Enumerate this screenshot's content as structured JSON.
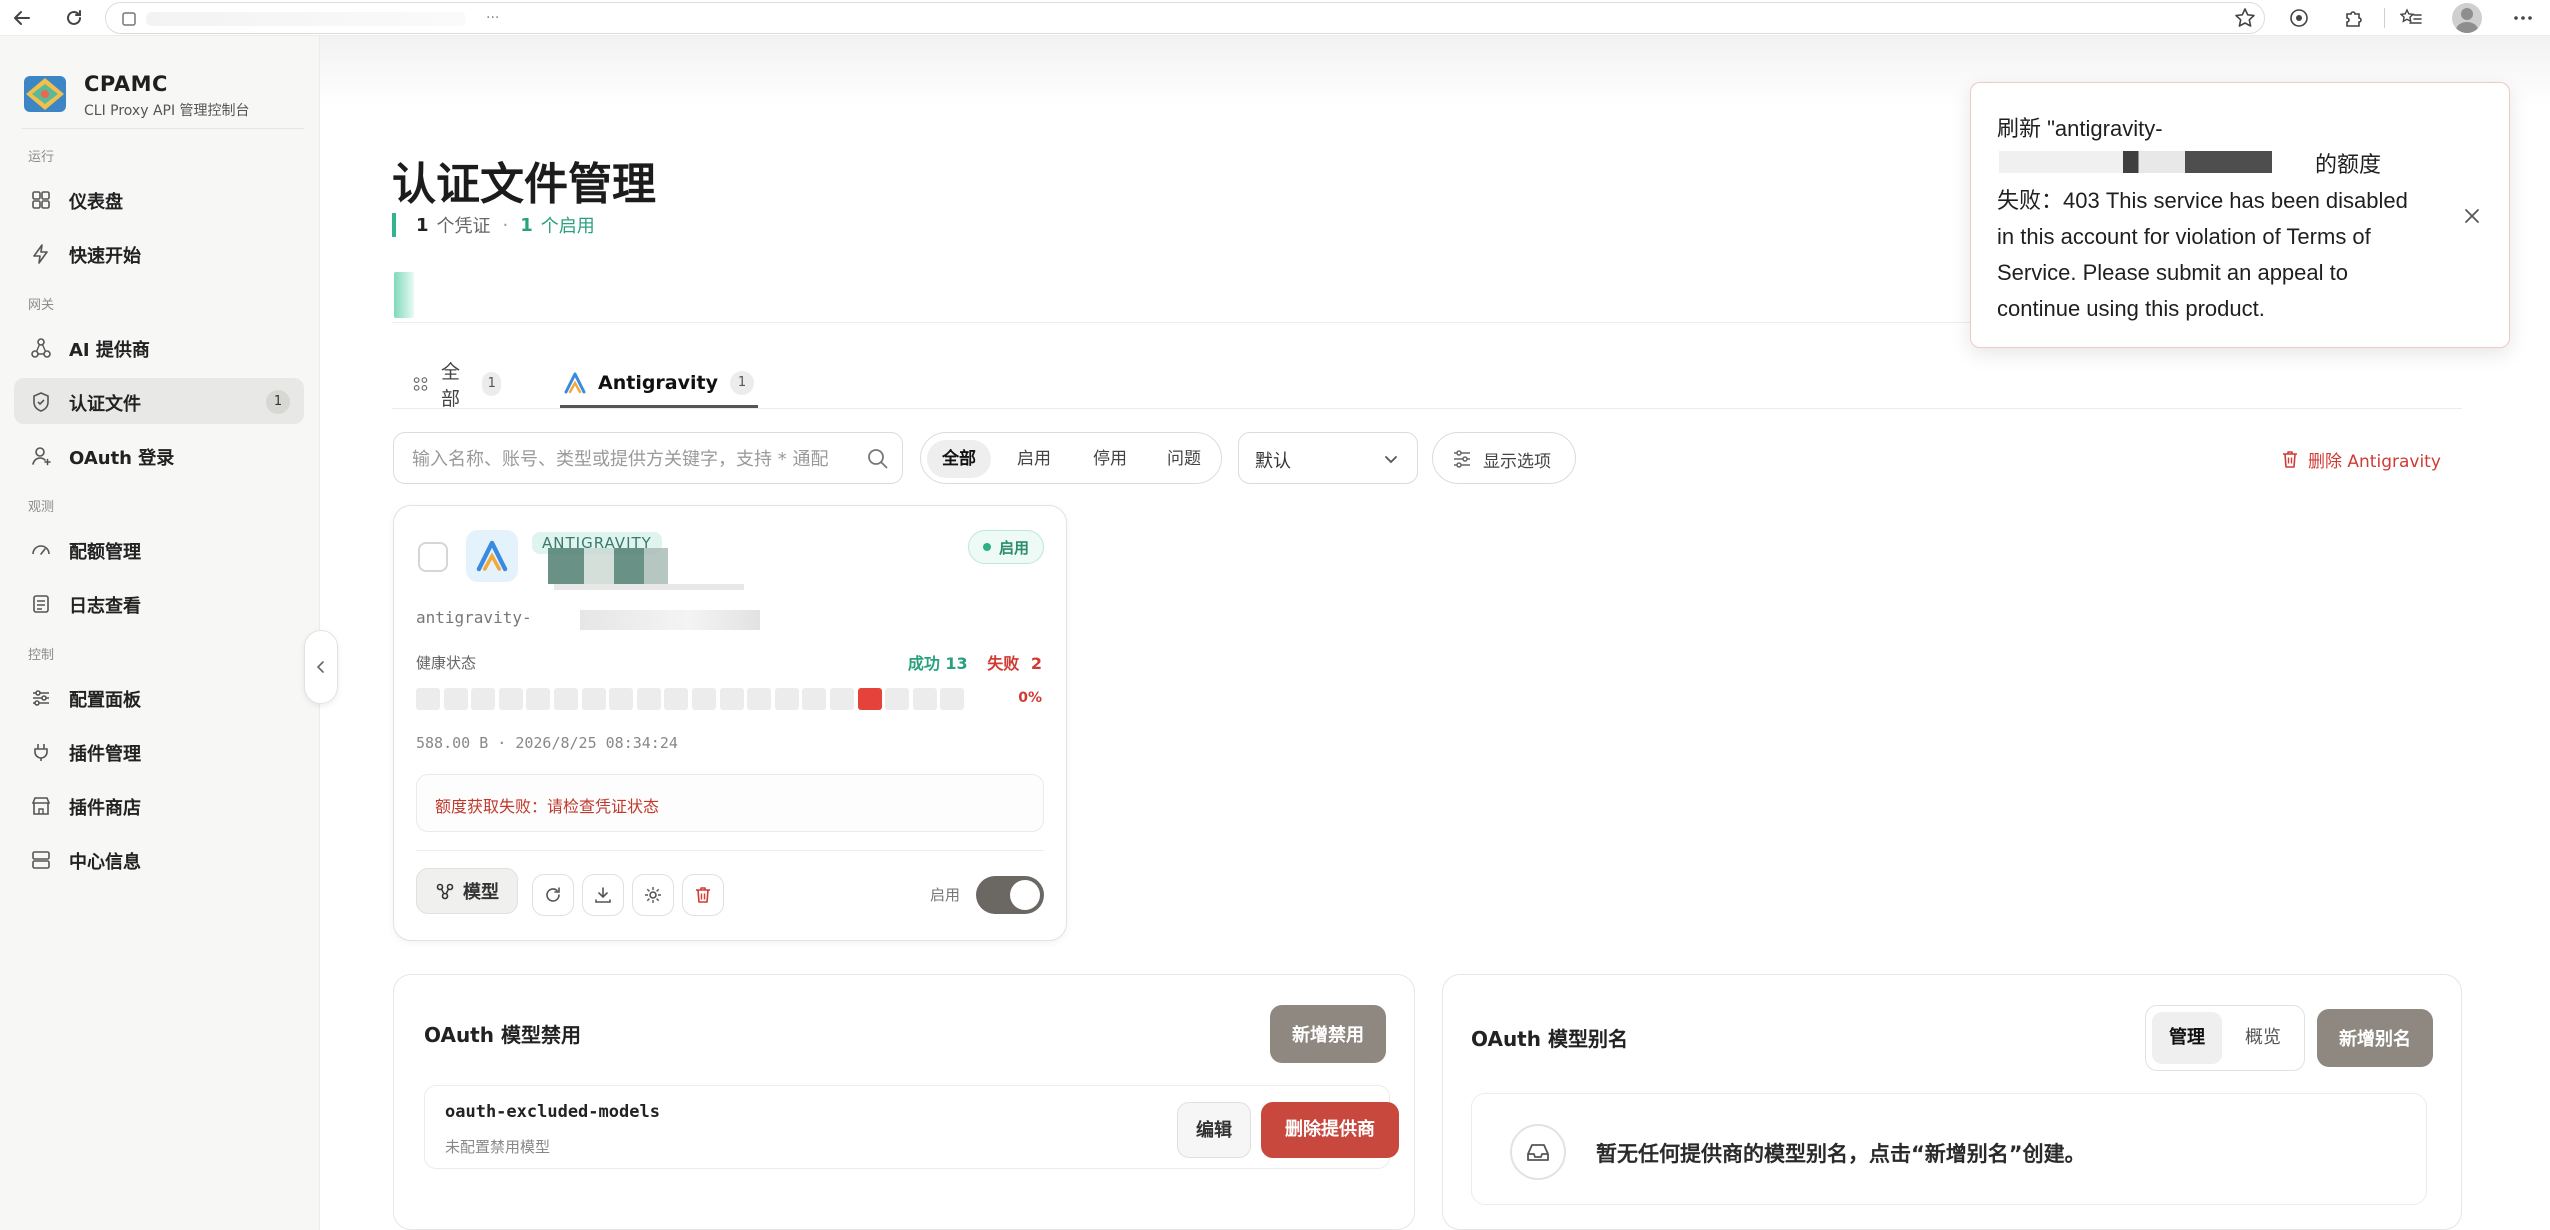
{
  "browser": {
    "address_ellipsis": "...",
    "back_icon": "back-arrow-icon",
    "reload_icon": "reload-icon"
  },
  "sidebar": {
    "brand": {
      "name": "CPAMC",
      "subtitle": "CLI Proxy API 管理控制台"
    },
    "sections": [
      {
        "label": "运行",
        "items": [
          {
            "label": "仪表盘",
            "icon": "dashboard-icon"
          },
          {
            "label": "快速开始",
            "icon": "bolt-icon"
          }
        ]
      },
      {
        "label": "网关",
        "items": [
          {
            "label": "AI 提供商",
            "icon": "providers-icon"
          },
          {
            "label": "认证文件",
            "icon": "shield-icon",
            "active": true,
            "count": "1"
          },
          {
            "label": "OAuth 登录",
            "icon": "user-icon"
          }
        ]
      },
      {
        "label": "观测",
        "items": [
          {
            "label": "配额管理",
            "icon": "gauge-icon"
          },
          {
            "label": "日志查看",
            "icon": "log-icon"
          }
        ]
      },
      {
        "label": "控制",
        "items": [
          {
            "label": "配置面板",
            "icon": "sliders-icon"
          },
          {
            "label": "插件管理",
            "icon": "plug-icon"
          },
          {
            "label": "插件商店",
            "icon": "store-icon"
          },
          {
            "label": "中心信息",
            "icon": "server-icon"
          }
        ]
      }
    ]
  },
  "page": {
    "title": "认证文件管理",
    "credentials_count": "1",
    "credentials_label": "个凭证",
    "separator": "·",
    "enabled_count": "1",
    "enabled_label": "个启用"
  },
  "tabs": [
    {
      "label": "全部",
      "count": "1",
      "icon": "all-icon"
    },
    {
      "label": "Antigravity",
      "count": "1",
      "icon": "antigravity-logo-icon",
      "active": true
    }
  ],
  "filters": {
    "search_placeholder": "输入名称、账号、类型或提供方关键字，支持 * 通配",
    "segments": [
      "全部",
      "启用",
      "停用",
      "问题"
    ],
    "active_segment": "全部",
    "sort_value": "默认",
    "display_options": "显示选项",
    "delete_provider": "删除 Antigravity"
  },
  "card": {
    "provider_badge": "ANTIGRAVITY",
    "status": "启用",
    "file_name": "antigravity-",
    "health_label": "健康状态",
    "success_label": "成功",
    "success_count": "13",
    "fail_label": "失败",
    "fail_count": "2",
    "health_cells": [
      "ok",
      "ok",
      "ok",
      "ok",
      "ok",
      "ok",
      "ok",
      "ok",
      "ok",
      "ok",
      "ok",
      "ok",
      "ok",
      "ok",
      "ok",
      "ok",
      "bad",
      "ok",
      "ok",
      "ok"
    ],
    "health_percent": "0%",
    "meta": "588.00 B · 2026/8/25 08:34:24",
    "error_text": "额度获取失败：请检查凭证状态",
    "models_button": "模型",
    "enable_label": "启用",
    "enabled": true
  },
  "excluded_panel": {
    "title": "OAuth 模型禁用",
    "add_button": "新增禁用",
    "row_name": "oauth-excluded-models",
    "row_sub": "未配置禁用模型",
    "edit_button": "编辑",
    "delete_button": "删除提供商"
  },
  "alias_panel": {
    "title": "OAuth 模型别名",
    "seg_manage": "管理",
    "seg_overview": "概览",
    "add_button": "新增别名",
    "empty_text": "暂无任何提供商的模型别名，点击“新增别名”创建。"
  },
  "toast": {
    "line1": "刷新 \"antigravity-",
    "line2_suffix": "的额度",
    "line3": "失败：403 This service has been disabled in this account for violation of Terms of Service. Please submit an appeal to continue using this product."
  },
  "colors": {
    "accent_green": "#2aa17e",
    "danger_red": "#d03b33",
    "dark_button": "#8e8881"
  }
}
